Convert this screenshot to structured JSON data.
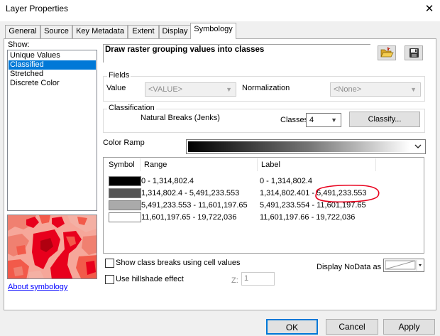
{
  "window": {
    "title": "Layer Properties",
    "close_glyph": "✕"
  },
  "tabs": [
    {
      "label": "General",
      "active": false
    },
    {
      "label": "Source",
      "active": false
    },
    {
      "label": "Key Metadata",
      "active": false
    },
    {
      "label": "Extent",
      "active": false
    },
    {
      "label": "Display",
      "active": false
    },
    {
      "label": "Symbology",
      "active": true
    }
  ],
  "show": {
    "label": "Show:",
    "items": [
      "Unique Values",
      "Classified",
      "Stretched",
      "Discrete Color"
    ],
    "selected": "Classified",
    "about_link": "About symbology"
  },
  "description": "Draw raster grouping values into classes",
  "icons": {
    "open": "folder-open-icon",
    "save": "save-disk-icon"
  },
  "fields": {
    "group_title": "Fields",
    "value_label": "Value",
    "value_selected": "<VALUE>",
    "normalization_label": "Normalization",
    "normalization_selected": "<None>"
  },
  "classification": {
    "group_title": "Classification",
    "method": "Natural Breaks (Jenks)",
    "classes_label": "Classes",
    "classes_value": "4",
    "classify_button": "Classify..."
  },
  "color_ramp": {
    "label": "Color Ramp",
    "from_color": "#000000",
    "to_color": "#ffffff"
  },
  "table": {
    "headers": {
      "symbol": "Symbol",
      "range": "Range",
      "label": "Label"
    },
    "rows": [
      {
        "color": "#000000",
        "range": "0 - 1,314,802.4",
        "label": "0 - 1,314,802.4"
      },
      {
        "color": "#555555",
        "range": "1,314,802.4 - 5,491,233.553",
        "label": "1,314,802.401 - 5,491,233.553"
      },
      {
        "color": "#aaaaaa",
        "range": "5,491,233.553 - 11,601,197.65",
        "label": "5,491,233.554 - 11,601,197.65"
      },
      {
        "color": "#ffffff",
        "range": "11,601,197.65 - 19,722,036",
        "label": "11,601,197.66 - 19,722,036"
      }
    ],
    "annotation_color": "#e8001c"
  },
  "options": {
    "show_class_breaks": {
      "label": "Show class breaks using cell values",
      "checked": false
    },
    "hillshade": {
      "label": "Use hillshade effect",
      "checked": false
    },
    "z_label": "Z:",
    "z_value": "1",
    "nodata_label": "Display NoData as"
  },
  "buttons": {
    "ok": "OK",
    "cancel": "Cancel",
    "apply": "Apply"
  }
}
